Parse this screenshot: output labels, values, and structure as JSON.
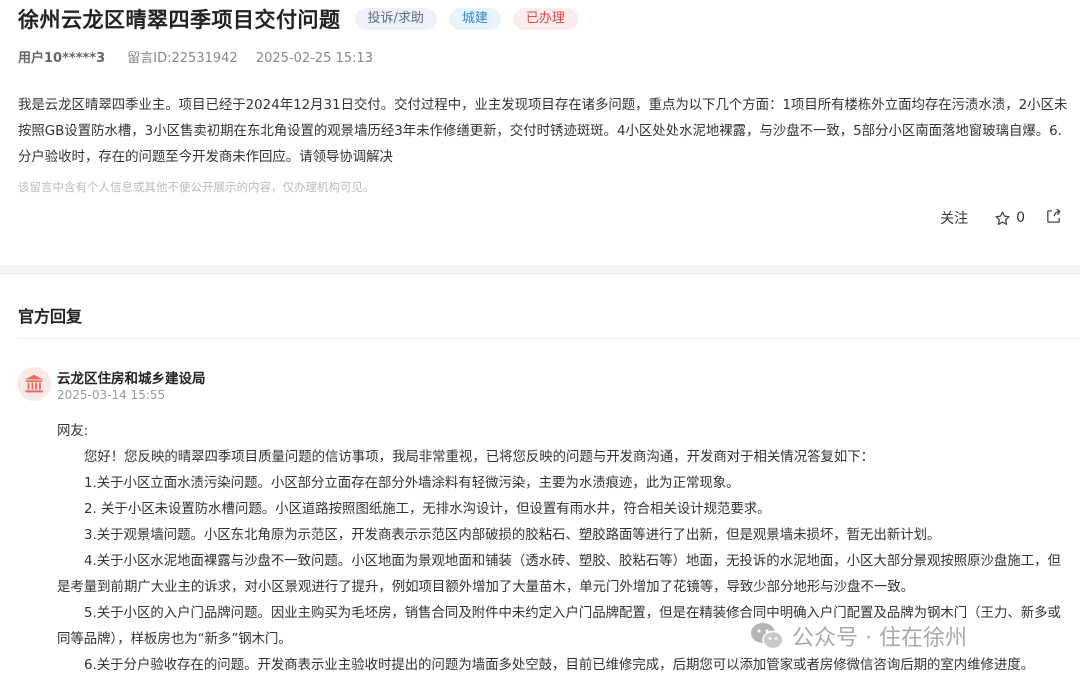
{
  "header": {
    "title": "徐州云龙区晴翠四季项目交付问题",
    "tags": [
      "投诉/求助",
      "城建",
      "已办理"
    ],
    "user": "用户10*****3",
    "message_id": "留言ID:22531942",
    "datetime": "2025-02-25 15:13"
  },
  "post": {
    "content": "我是云龙区晴翠四季业主。项目已经于2024年12月31日交付。交付过程中，业主发现项目存在诸多问题，重点为以下几个方面：1项目所有楼栋外立面均存在污渍水渍，2小区未按照GB设置防水槽，3小区售卖初期在东北角设置的观景墙历经3年未作修缮更新，交付时锈迹斑斑。4小区处处水泥地裸露，与沙盘不一致，5部分小区南面落地窗玻璃自爆。6.分户验收时，存在的问题至今开发商未作回应。请领导协调解决",
    "privacy_note": "该留言中含有个人信息或其他不便公开展示的内容，仅办理机构可见。",
    "actions": {
      "follow_label": "关注",
      "like_count": "0"
    }
  },
  "reply": {
    "section_title": "官方回复",
    "department": "云龙区住房和城乡建设局",
    "datetime": "2025-03-14 15:55",
    "greeting": "网友:",
    "paragraphs": [
      "您好！您反映的晴翠四季项目质量问题的信访事项，我局非常重视，已将您反映的问题与开发商沟通，开发商对于相关情况答复如下：",
      "1.关于小区立面水渍污染问题。小区部分立面存在部分外墙涂料有轻微污染，主要为水渍痕迹，此为正常现象。",
      "2. 关于小区未设置防水槽问题。小区道路按照图纸施工，无排水沟设计，但设置有雨水井，符合相关设计规范要求。",
      "3.关于观景墙问题。小区东北角原为示范区，开发商表示示范区内部破损的胶粘石、塑胶路面等进行了出新，但是观景墙未损坏，暂无出新计划。",
      "4.关于小区水泥地面裸露与沙盘不一致问题。小区地面为景观地面和铺装（透水砖、塑胶、胶粘石等）地面，无投诉的水泥地面，小区大部分景观按照原沙盘施工，但是考量到前期广大业主的诉求，对小区景观进行了提升，例如项目额外增加了大量苗木，单元门外增加了花镜等，导致少部分地形与沙盘不一致。",
      "5.关于小区的入户门品牌问题。因业主购买为毛坯房，销售合同及附件中未约定入户门品牌配置，但是在精装修合同中明确入户门配置及品牌为钢木门（王力、新多或同等品牌），样板房也为“新多”钢木门。",
      "6.关于分户验收存在的问题。开发商表示业主验收时提出的问题为墙面多处空鼓，目前已维修完成，后期您可以添加管家或者房修微信咨询后期的室内维修进度。"
    ]
  },
  "watermark": {
    "text": "公众号 · 住在徐州"
  }
}
